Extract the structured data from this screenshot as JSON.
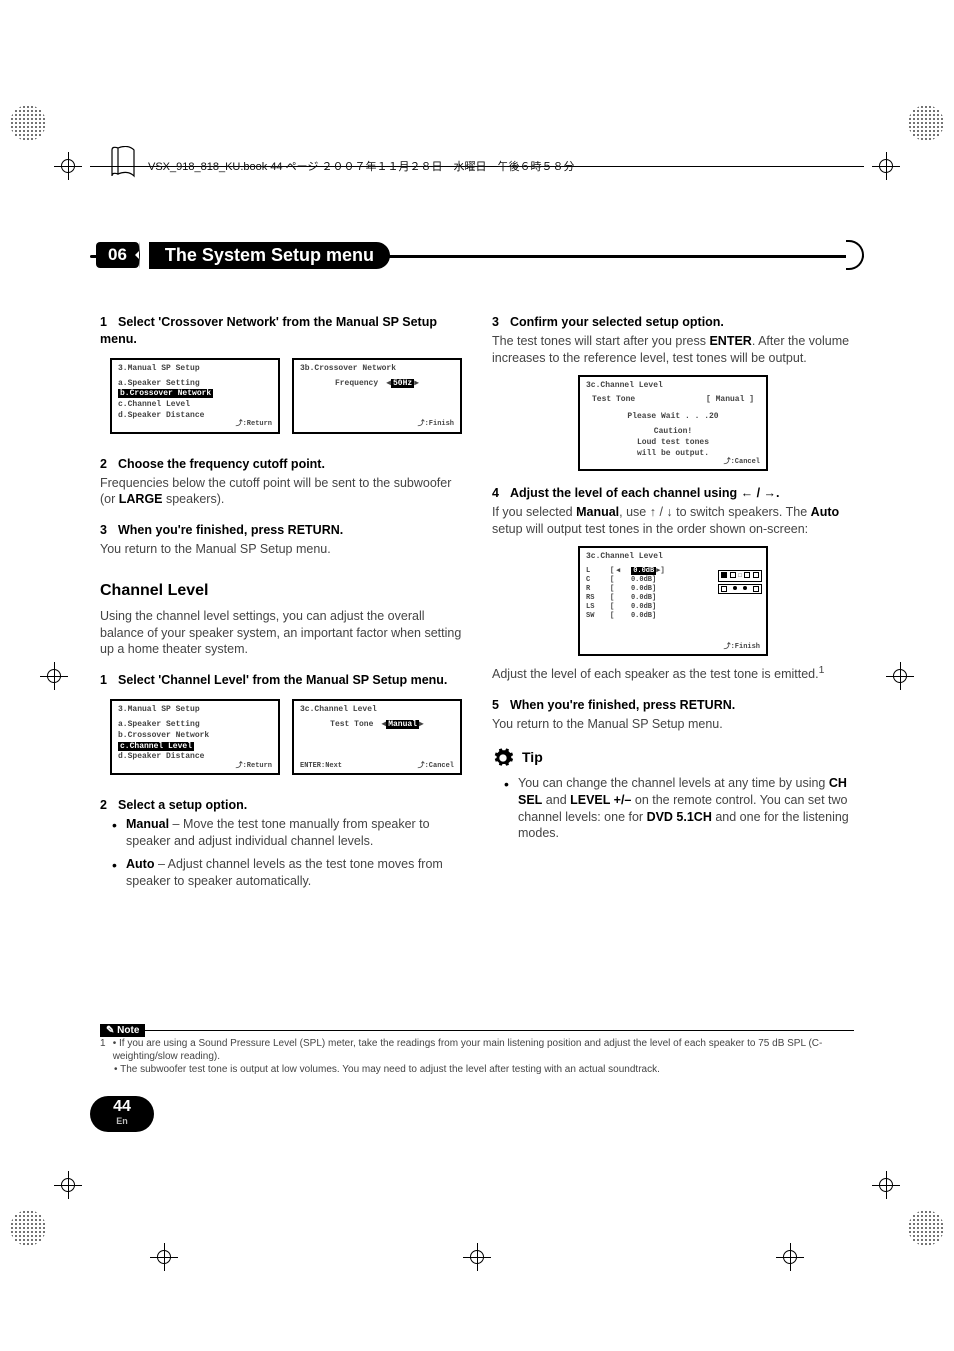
{
  "header": {
    "book_line": "VSX_918_818_KU.book  44 ページ  ２００７年１１月２８日　水曜日　午後６時５８分"
  },
  "chapter": {
    "number": "06",
    "title": "The System Setup menu"
  },
  "left": {
    "step1": "Select 'Crossover Network' from the Manual SP Setup menu.",
    "osd1": {
      "title": "3.Manual  SP  Setup",
      "items": [
        "a.Speaker  Setting",
        "b.Crossover  Network",
        "c.Channel  Level",
        "d.Speaker  Distance"
      ],
      "highlight_index": 1,
      "footer_right": ":Return"
    },
    "osd2": {
      "title": "3b.Crossover  Network",
      "label": "Frequency",
      "value": "50Hz",
      "footer_right": ":Finish"
    },
    "step2": "Choose the frequency cutoff point.",
    "step2_body_a": "Frequencies below the cutoff point will be sent to the subwoofer (or ",
    "step2_body_b": "LARGE",
    "step2_body_c": " speakers).",
    "step3": "When you're finished, press RETURN.",
    "step3_body": "You return to the Manual SP Setup menu.",
    "section": "Channel Level",
    "section_body": "Using the channel level settings, you can adjust the overall balance of your speaker system, an important factor when setting up a home theater system.",
    "cl_step1": "Select 'Channel Level' from the Manual SP Setup menu.",
    "osd3": {
      "title": "3.Manual  SP  Setup",
      "items": [
        "a.Speaker  Setting",
        "b.Crossover  Network",
        "c.Channel  Level",
        "d.Speaker  Distance"
      ],
      "highlight_index": 2,
      "footer_right": ":Return"
    },
    "osd4": {
      "title": "3c.Channel  Level",
      "label": "Test  Tone",
      "value": "Manual",
      "footer_left": "ENTER:Next",
      "footer_right": ":Cancel"
    },
    "cl_step2": "Select a setup option.",
    "bullet1_head": "Manual",
    "bullet1_body": " – Move the test tone manually from speaker to speaker and adjust individual channel levels.",
    "bullet2_head": "Auto",
    "bullet2_body": " – Adjust channel levels as the test tone moves from speaker to speaker automatically."
  },
  "right": {
    "step3": "Confirm your selected setup option.",
    "step3_body_a": "The test tones will start after you press ",
    "step3_body_b": "ENTER",
    "step3_body_c": ". After the volume increases to the reference level, test tones will be output.",
    "osd5": {
      "title": "3c.Channel  Level",
      "line1_l": "Test  Tone",
      "line1_r": "[ Manual ]",
      "wait": "Please  Wait . . .20",
      "caution1": "Caution!",
      "caution2": "Loud  test  tones",
      "caution3": "will  be  output.",
      "footer_right": ":Cancel"
    },
    "step4": "Adjust the level of each channel using ",
    "step4_arrows": "← / →",
    "step4_dot": ".",
    "step4_body_a": "If you selected ",
    "step4_body_b": "Manual",
    "step4_body_c": ", use ",
    "step4_arrows2": "↑ / ↓",
    "step4_body_d": " to switch speakers. The ",
    "step4_body_e": "Auto",
    "step4_body_f": " setup will output test tones in the order shown on-screen:",
    "osd6": {
      "title": "3c.Channel  Level",
      "rows": [
        {
          "ch": "L",
          "val": "0.0dB",
          "hi": true
        },
        {
          "ch": "C",
          "val": "0.0dB"
        },
        {
          "ch": "R",
          "val": "0.0dB"
        },
        {
          "ch": "RS",
          "val": "0.0dB"
        },
        {
          "ch": "LS",
          "val": "0.0dB"
        },
        {
          "ch": "SW",
          "val": "0.0dB"
        }
      ],
      "footer_right": ":Finish"
    },
    "after_osd6_a": "Adjust the level of each speaker as the test tone is emitted.",
    "fn_ref": "1",
    "step5": "When you're finished, press RETURN.",
    "step5_body": "You return to the Manual SP Setup menu.",
    "tip_label": "Tip",
    "tip_body_a": "You can change the channel levels at any time by using ",
    "tip_b1": "CH SEL",
    "tip_body_b": " and ",
    "tip_b2": "LEVEL +/–",
    "tip_body_c": " on the remote control. You can set two channel levels: one for ",
    "tip_b3": "DVD 5.1CH",
    "tip_body_d": " and one for the listening modes."
  },
  "note": {
    "label": "Note",
    "num": "1",
    "line1": "• If you are using a Sound Pressure Level (SPL) meter, take the readings from your main listening position and adjust the level of each speaker to 75 dB SPL (C-weighting/slow reading).",
    "line2": "• The subwoofer test tone is output at low volumes. You may need to adjust the level after testing with an actual soundtrack."
  },
  "page": {
    "number": "44",
    "lang": "En"
  }
}
